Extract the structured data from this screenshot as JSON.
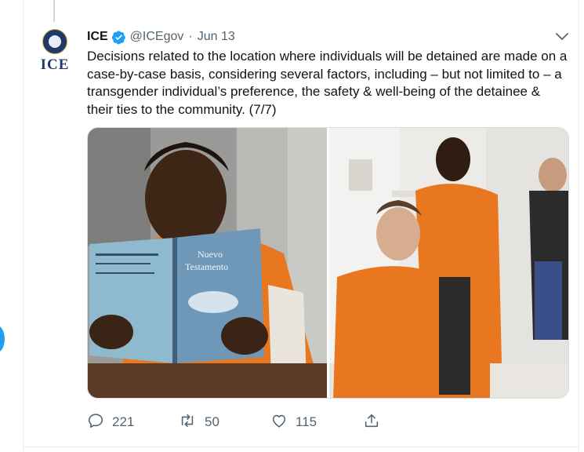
{
  "tweet": {
    "author_name": "ICE",
    "handle": "@ICEgov",
    "separator": "·",
    "date": "Jun 13",
    "text": "Decisions related to the location where individuals will be detained are made on a case-by-case basis, considering several factors, including – but not limited to – a transgender individual’s preference, the safety & well-being of the detainee & their ties to the community. (7/7)",
    "avatar_label": "ICE",
    "verified": true
  },
  "media": {
    "left_photo_book_title_line1": "Nuevo",
    "left_photo_book_title_line2": "Testamento",
    "photos": [
      "detainee-reading-photo",
      "detainees-hair-styling-photo"
    ]
  },
  "actions": {
    "reply_count": "221",
    "retweet_count": "50",
    "like_count": "115"
  },
  "colors": {
    "accent": "#1da1f2",
    "secondary_text": "#536471",
    "prison_orange": "#e8771f"
  }
}
